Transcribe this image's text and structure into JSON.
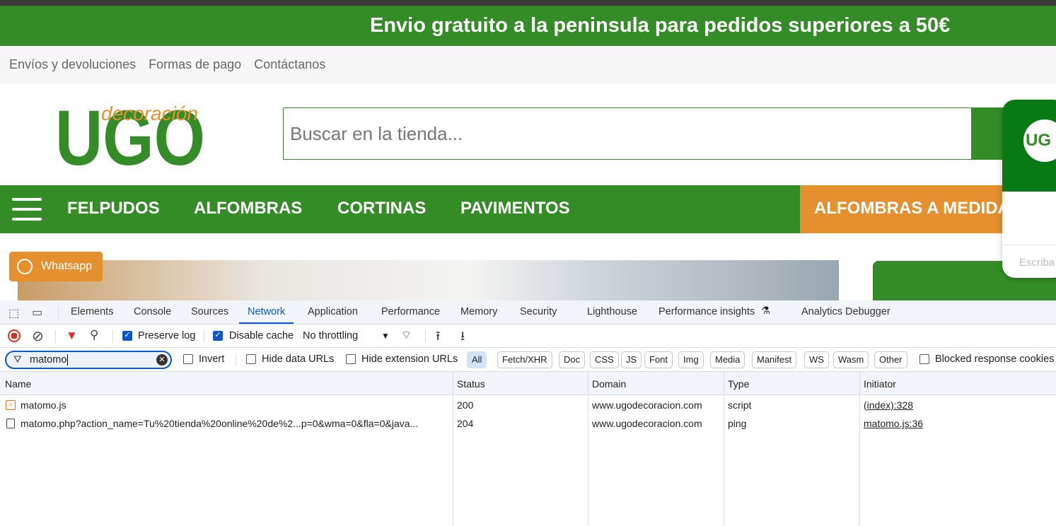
{
  "site": {
    "banner": "Envio gratuito a la peninsula para pedidos superiores a 50€",
    "top_links": [
      "Envíos y devoluciones",
      "Formas de pago",
      "Contáctanos"
    ],
    "logo_text": "UGO decoración",
    "search_placeholder": "Buscar en la tienda...",
    "nav": [
      "FELPUDOS",
      "ALFOMBRAS",
      "CORTINAS",
      "PAVIMENTOS"
    ],
    "nav_highlight": "ALFOMBRAS A MEDIDA",
    "whatsapp": "Whatsapp",
    "chat_placeholder": "Escriba"
  },
  "devtools": {
    "tabs": [
      "Elements",
      "Console",
      "Sources",
      "Network",
      "Application",
      "Performance",
      "Memory",
      "Security",
      "Lighthouse",
      "Performance insights",
      "Analytics Debugger"
    ],
    "active_tab": "Network",
    "toolbar": {
      "preserve_log": "Preserve log",
      "disable_cache": "Disable cache",
      "throttling": "No throttling"
    },
    "filter": {
      "value": "matomo",
      "invert": "Invert",
      "hide_data": "Hide data URLs",
      "hide_ext": "Hide extension URLs",
      "blocked": "Blocked response cookies"
    },
    "types": [
      "All",
      "Fetch/XHR",
      "Doc",
      "CSS",
      "JS",
      "Font",
      "Img",
      "Media",
      "Manifest",
      "WS",
      "Wasm",
      "Other"
    ],
    "columns": [
      "Name",
      "Status",
      "Domain",
      "Type",
      "Initiator"
    ],
    "rows": [
      {
        "name": "matomo.js",
        "status": "200",
        "domain": "www.ugodecoracion.com",
        "type": "script",
        "initiator": "(index):328"
      },
      {
        "name": "matomo.php?action_name=Tu%20tienda%20online%20de%2...p=0&wma=0&fla=0&java...",
        "status": "204",
        "domain": "www.ugodecoracion.com",
        "type": "ping",
        "initiator": "matomo.js:36"
      }
    ]
  },
  "colors": {
    "green": "#348c26",
    "orange": "#e4902e",
    "blue": "#0b57d0"
  }
}
